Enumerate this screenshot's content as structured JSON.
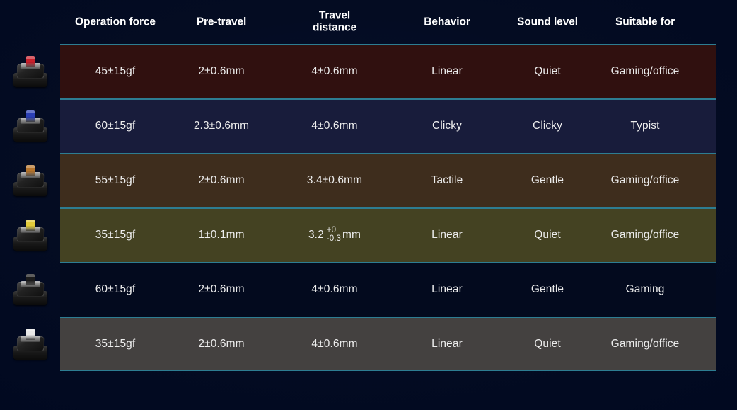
{
  "theme": {
    "background": "#000820",
    "divider": "#2d7d92",
    "text": "#ededed",
    "header_text": "#ffffff"
  },
  "table": {
    "columns": [
      {
        "key": "operation_force",
        "label": "Operation force"
      },
      {
        "key": "pre_travel",
        "label": "Pre-travel"
      },
      {
        "key": "travel_distance",
        "label": "Travel\ndistance"
      },
      {
        "key": "behavior",
        "label": "Behavior"
      },
      {
        "key": "sound_level",
        "label": "Sound level"
      },
      {
        "key": "suitable_for",
        "label": "Suitable for"
      }
    ],
    "rows": [
      {
        "switch_name": "red-switch",
        "stem_color": "#c8202c",
        "row_color": "#30100f",
        "operation_force": "45±15gf",
        "pre_travel": "2±0.6mm",
        "travel_distance": "4±0.6mm",
        "behavior": "Linear",
        "sound_level": "Quiet",
        "suitable_for": "Gaming/office"
      },
      {
        "switch_name": "blue-switch",
        "stem_color": "#2b3fb5",
        "row_color": "#181c3b",
        "operation_force": "60±15gf",
        "pre_travel": "2.3±0.6mm",
        "travel_distance": "4±0.6mm",
        "behavior": "Clicky",
        "sound_level": "Clicky",
        "suitable_for": "Typist"
      },
      {
        "switch_name": "brown-switch",
        "stem_color": "#b5742c",
        "row_color": "#3e2d1d",
        "operation_force": "55±15gf",
        "pre_travel": "2±0.6mm",
        "travel_distance": "3.4±0.6mm",
        "behavior": "Tactile",
        "sound_level": "Gentle",
        "suitable_for": "Gaming/office"
      },
      {
        "switch_name": "yellow-switch",
        "stem_color": "#e2cb3a",
        "row_color": "#444222",
        "operation_force": "35±15gf",
        "pre_travel": "1±0.1mm",
        "travel_distance_parts": {
          "base": "3.2",
          "upper": "+0",
          "lower": "-0.3",
          "unit": "mm"
        },
        "behavior": "Linear",
        "sound_level": "Quiet",
        "suitable_for": "Gaming/office"
      },
      {
        "switch_name": "black-switch",
        "stem_color": "#1b1b1b",
        "row_color": "#030a1e",
        "operation_force": "60±15gf",
        "pre_travel": "2±0.6mm",
        "travel_distance": "4±0.6mm",
        "behavior": "Linear",
        "sound_level": "Gentle",
        "suitable_for": "Gaming"
      },
      {
        "switch_name": "silver-switch",
        "stem_color": "#e8e8e8",
        "row_color": "#444140",
        "operation_force": "35±15gf",
        "pre_travel": "2±0.6mm",
        "travel_distance": "4±0.6mm",
        "behavior": "Linear",
        "sound_level": "Quiet",
        "suitable_for": "Gaming/office"
      }
    ]
  }
}
